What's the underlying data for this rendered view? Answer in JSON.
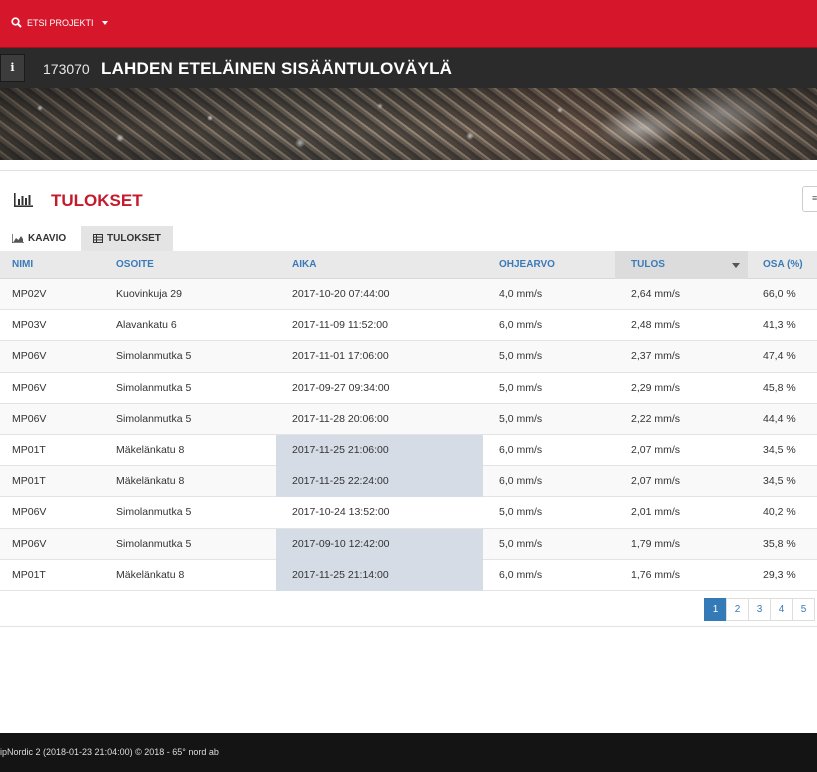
{
  "topbar": {
    "search_label": "ETSI PROJEKTI"
  },
  "project": {
    "number": "173070",
    "name": "LAHDEN ETELÄINEN SISÄÄNTULOVÄYLÄ",
    "info_label": "i"
  },
  "section": {
    "title": "TULOKSET"
  },
  "tabs": [
    {
      "label": "KAAVIO"
    },
    {
      "label": "TULOKSET"
    }
  ],
  "table": {
    "columns": [
      "NIMI",
      "OSOITE",
      "AIKA",
      "OHJEARVO",
      "TULOS",
      "OSA (%)"
    ],
    "rows": [
      {
        "nimi": "MP02V",
        "osoite": "Kuovinkuja 29",
        "aika": "2017-10-20 07:44:00",
        "ohjearvo": "4,0 mm/s",
        "tulos": "2,64 mm/s",
        "osa": "66,0 %"
      },
      {
        "nimi": "MP03V",
        "osoite": "Alavankatu 6",
        "aika": "2017-11-09 11:52:00",
        "ohjearvo": "6,0 mm/s",
        "tulos": "2,48 mm/s",
        "osa": "41,3 %"
      },
      {
        "nimi": "MP06V",
        "osoite": "Simolanmutka 5",
        "aika": "2017-11-01 17:06:00",
        "ohjearvo": "5,0 mm/s",
        "tulos": "2,37 mm/s",
        "osa": "47,4 %"
      },
      {
        "nimi": "MP06V",
        "osoite": "Simolanmutka 5",
        "aika": "2017-09-27 09:34:00",
        "ohjearvo": "5,0 mm/s",
        "tulos": "2,29 mm/s",
        "osa": "45,8 %"
      },
      {
        "nimi": "MP06V",
        "osoite": "Simolanmutka 5",
        "aika": "2017-11-28 20:06:00",
        "ohjearvo": "5,0 mm/s",
        "tulos": "2,22 mm/s",
        "osa": "44,4 %"
      },
      {
        "nimi": "MP01T",
        "osoite": "Mäkelänkatu 8",
        "aika": "2017-11-25 21:06:00",
        "ohjearvo": "6,0 mm/s",
        "tulos": "2,07 mm/s",
        "osa": "34,5 %"
      },
      {
        "nimi": "MP01T",
        "osoite": "Mäkelänkatu 8",
        "aika": "2017-11-25 22:24:00",
        "ohjearvo": "6,0 mm/s",
        "tulos": "2,07 mm/s",
        "osa": "34,5 %"
      },
      {
        "nimi": "MP06V",
        "osoite": "Simolanmutka 5",
        "aika": "2017-10-24 13:52:00",
        "ohjearvo": "5,0 mm/s",
        "tulos": "2,01 mm/s",
        "osa": "40,2 %"
      },
      {
        "nimi": "MP06V",
        "osoite": "Simolanmutka 5",
        "aika": "2017-09-10 12:42:00",
        "ohjearvo": "5,0 mm/s",
        "tulos": "1,79 mm/s",
        "osa": "35,8 %"
      },
      {
        "nimi": "MP01T",
        "osoite": "Mäkelänkatu 8",
        "aika": "2017-11-25 21:14:00",
        "ohjearvo": "6,0 mm/s",
        "tulos": "1,76 mm/s",
        "osa": "29,3 %"
      }
    ]
  },
  "pagination": {
    "pages": [
      "1",
      "2",
      "3",
      "4",
      "5"
    ],
    "current": "1"
  },
  "footer": {
    "text": "ipNordic 2 (2018-01-23 21:04:00) © 2018 - 65° nord ab"
  },
  "colors": {
    "brand_red": "#d6162a",
    "title_red": "#c41a2c",
    "link_blue": "#3b7ab8",
    "highlight": "#d5dce6"
  },
  "icons": {
    "search": "search-icon",
    "info": "info-icon",
    "chart": "bar-chart-icon",
    "table": "table-icon",
    "menu": "list-icon"
  }
}
